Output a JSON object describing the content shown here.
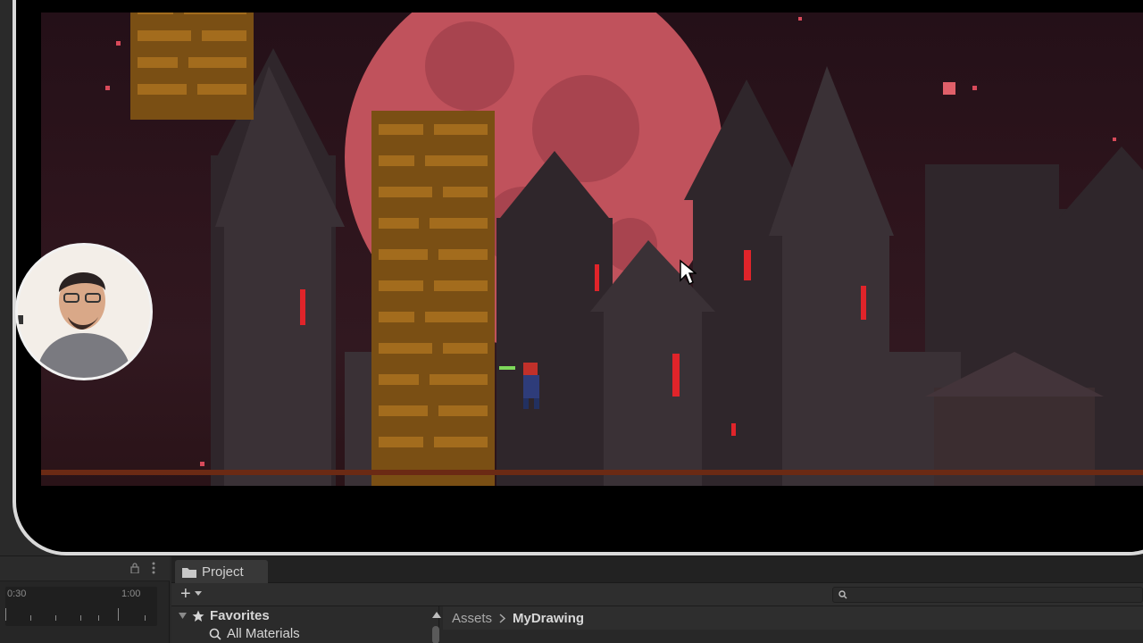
{
  "game": {
    "scene": "castle-night-level",
    "colors": {
      "moon": "#c0525c",
      "moon_dark": "#9a3e48",
      "sky": "#2a1218",
      "castle": "#3a3035",
      "castle_dark": "#2b2428",
      "brick": "#8a5a18",
      "brick_light": "#a8701e",
      "window_glow": "#e0242a",
      "ground": "#6b2a14"
    },
    "player": {
      "state": "standing",
      "weapon": "green-sword"
    }
  },
  "webcam": {
    "visible": true
  },
  "timeline": {
    "ruler_start": "0:30",
    "ruler_end": "1:00"
  },
  "project_panel": {
    "tab_label": "Project",
    "add_label": "+",
    "search_placeholder": "",
    "tree": {
      "favorites_label": "Favorites",
      "all_materials_label": "All Materials"
    },
    "breadcrumb": [
      "Assets",
      "MyDrawing"
    ]
  }
}
